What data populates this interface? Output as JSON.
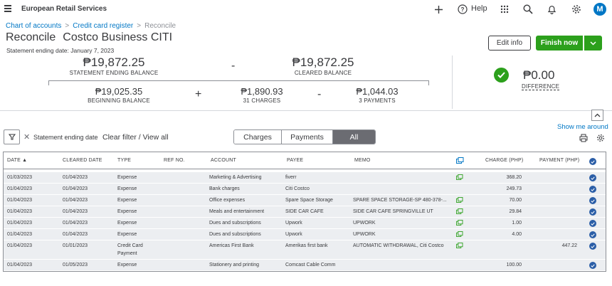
{
  "topbar": {
    "company": "European Retail Services",
    "help_label": "Help",
    "avatar_letter": "M"
  },
  "breadcrumb": {
    "item1": "Chart of accounts",
    "item2": "Credit card register",
    "sep": ">",
    "current": "Reconcile"
  },
  "page": {
    "title": "Reconcile",
    "account": "Costco Business CITI",
    "statement_date": "Statement ending date: January 7, 2023"
  },
  "buttons": {
    "edit_info": "Edit info",
    "finish_now": "Finish now"
  },
  "summary": {
    "statement_ending_balance": "₱19,872.25",
    "statement_ending_balance_label": "STATEMENT ENDING BALANCE",
    "minus1": "-",
    "cleared_balance": "₱19,872.25",
    "cleared_balance_label": "CLEARED BALANCE",
    "beginning_balance": "₱19,025.35",
    "beginning_balance_label": "BEGINNING BALANCE",
    "plus": "+",
    "charges": "₱1,890.93",
    "charges_label": "31 CHARGES",
    "minus2": "-",
    "payments": "₱1,044.03",
    "payments_label": "3 PAYMENTS",
    "difference": "₱0.00",
    "difference_label": "DIFFERENCE"
  },
  "show_me_around": "Show me around",
  "filter": {
    "active_filter": "Statement ending date",
    "clear_filter": "Clear filter / View all"
  },
  "tabs": [
    "Charges",
    "Payments",
    "All"
  ],
  "selected_tab": "All",
  "table": {
    "headers": {
      "date": "DATE ▲",
      "cleared_date": "CLEARED DATE",
      "type": "TYPE",
      "ref_no": "REF NO.",
      "account": "ACCOUNT",
      "payee": "PAYEE",
      "memo": "MEMO",
      "charge": "CHARGE (PHP)",
      "payment": "PAYMENT (PHP)"
    },
    "rows": [
      {
        "date": "01/03/2023",
        "cleared": "01/04/2023",
        "type": "Expense",
        "ref": "",
        "account": "Marketing & Advertising",
        "payee": "fiverr",
        "memo": "",
        "charge": "368.20",
        "payment": "",
        "attach": true
      },
      {
        "date": "01/04/2023",
        "cleared": "01/04/2023",
        "type": "Expense",
        "ref": "",
        "account": "Bank charges",
        "payee": "Citi Costco",
        "memo": "",
        "charge": "249.73",
        "payment": "",
        "attach": false
      },
      {
        "date": "01/04/2023",
        "cleared": "01/04/2023",
        "type": "Expense",
        "ref": "",
        "account": "Office expenses",
        "payee": "Spare Space Storage",
        "memo": "SPARE SPACE STORAGE-SP 480-378-...",
        "charge": "70.00",
        "payment": "",
        "attach": true
      },
      {
        "date": "01/04/2023",
        "cleared": "01/04/2023",
        "type": "Expense",
        "ref": "",
        "account": "Meals and entertainment",
        "payee": "SIDE CAR CAFE",
        "memo": "SIDE CAR CAFE SPRINGVILLE UT",
        "charge": "29.84",
        "payment": "",
        "attach": true
      },
      {
        "date": "01/04/2023",
        "cleared": "01/04/2023",
        "type": "Expense",
        "ref": "",
        "account": "Dues and subscriptions",
        "payee": "Upwork",
        "memo": "UPWORK",
        "charge": "1.00",
        "payment": "",
        "attach": true
      },
      {
        "date": "01/04/2023",
        "cleared": "01/04/2023",
        "type": "Expense",
        "ref": "",
        "account": "Dues and subscriptions",
        "payee": "Upwork",
        "memo": "UPWORK",
        "charge": "4.00",
        "payment": "",
        "attach": true
      },
      {
        "date": "01/04/2023",
        "cleared": "01/01/2023",
        "type": "Credit Card Payment",
        "ref": "",
        "account": "Americas First Bank",
        "payee": "Amerikas first bank",
        "memo": "AUTOMATIC WITHDRAWAL, Citi Costco",
        "charge": "",
        "payment": "447.22",
        "attach": true
      },
      {
        "date": "01/04/2023",
        "cleared": "01/05/2023",
        "type": "Expense",
        "ref": "",
        "account": "Stationery and printing",
        "payee": "Comcast Cable Comm",
        "memo": "",
        "charge": "100.00",
        "payment": "",
        "attach": false
      }
    ]
  },
  "colors": {
    "brand_green": "#2ca01c",
    "link_blue": "#0077c5",
    "row_bg": "#eceef1"
  }
}
